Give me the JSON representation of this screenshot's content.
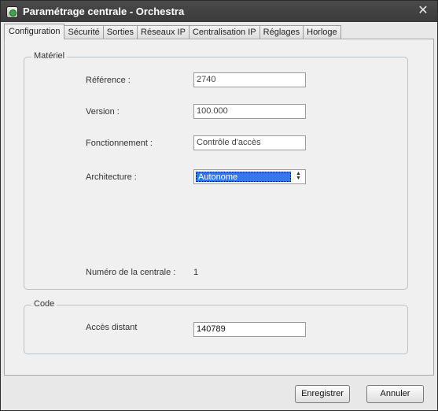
{
  "window": {
    "title": "Paramétrage centrale - Orchestra"
  },
  "tabs": [
    {
      "label": "Configuration"
    },
    {
      "label": "Sécurité"
    },
    {
      "label": "Sorties"
    },
    {
      "label": "Réseaux IP"
    },
    {
      "label": "Centralisation IP"
    },
    {
      "label": "Réglages"
    },
    {
      "label": "Horloge"
    }
  ],
  "active_tab": "Configuration",
  "materiel": {
    "legend": "Matériel",
    "reference": {
      "label": "Référence :",
      "value": "2740"
    },
    "version": {
      "label": "Version :",
      "value": "100.000"
    },
    "fonctionnement": {
      "label": "Fonctionnement :",
      "value": "Contrôle d'accès"
    },
    "architecture": {
      "label": "Architecture :",
      "value": "Autonome"
    },
    "numero": {
      "label": "Numéro de la centrale :",
      "value": "1"
    }
  },
  "code": {
    "legend": "Code",
    "acces_distant": {
      "label": "Accès distant",
      "value": "140789"
    }
  },
  "buttons": {
    "save": "Enregistrer",
    "cancel": "Annuler"
  },
  "icons": {
    "app": "app-icon",
    "close": "close-icon"
  },
  "colors": {
    "titlebar": "#3a3a3a",
    "selection": "#2f79ea"
  }
}
